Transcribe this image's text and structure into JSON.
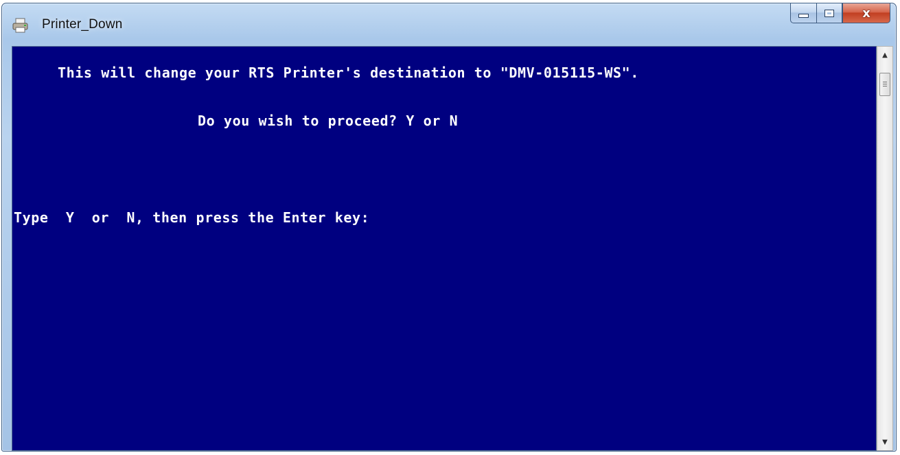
{
  "window": {
    "title": "Printer_Down"
  },
  "console": {
    "background_color": "#000080",
    "text_color": "#FFFFFF",
    "line1": "This will change your RTS Printer's destination to \"DMV-015115-WS\".",
    "line2": "Do you wish to proceed? Y or N",
    "line3": "Type  Y  or  N, then press the Enter key:"
  },
  "caption_buttons": {
    "minimize_icon": "minimize-icon",
    "maximize_icon": "maximize-icon",
    "close_icon": "close-icon",
    "close_glyph": "x"
  },
  "scrollbar": {
    "up_glyph": "▲",
    "down_glyph": "▼"
  }
}
